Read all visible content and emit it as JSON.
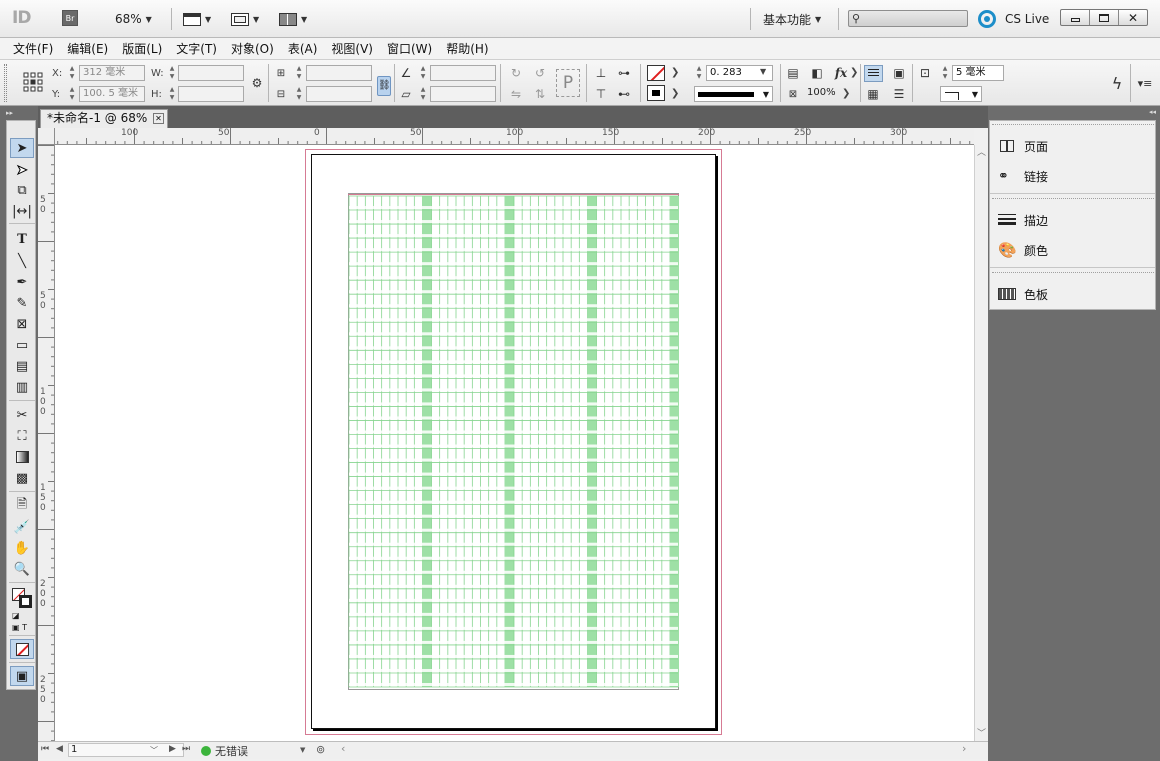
{
  "app": {
    "logo": "ID",
    "bridge_label": "Br",
    "zoom": "68%",
    "workspace": "基本功能",
    "search_placeholder": "",
    "cs_live": "CS Live"
  },
  "menu": [
    "文件(F)",
    "编辑(E)",
    "版面(L)",
    "文字(T)",
    "对象(O)",
    "表(A)",
    "视图(V)",
    "窗口(W)",
    "帮助(H)"
  ],
  "control": {
    "x_label": "X:",
    "x_value": "312 毫米",
    "y_label": "Y:",
    "y_value": "100. 5 毫米",
    "w_label": "W:",
    "h_label": "H:",
    "stroke_weight": "0. 283",
    "opacity": "100%",
    "gap_value": "5 毫米",
    "p_label": "P"
  },
  "document": {
    "tab_title": "*未命名-1 @ 68%",
    "ruler_h": [
      "100",
      "50",
      "0",
      "50",
      "100",
      "150",
      "200",
      "250",
      "300"
    ],
    "ruler_v": [
      "5",
      "0",
      "5",
      "0",
      "1",
      "0",
      "0",
      "1",
      "5",
      "0",
      "2",
      "0",
      "0",
      "2",
      "5",
      "0"
    ],
    "page_field": "1",
    "preflight": "无错误"
  },
  "grid": {
    "columns": 4,
    "cols_per_block": 9,
    "rows": 35,
    "line_color": "#86d48f",
    "bar_color": "#9ee0a6"
  },
  "colors": {
    "accent": "#c2d8ee",
    "margin_pink": "#d67b94",
    "panel_dark": "#6d6d6d"
  },
  "panels": [
    {
      "icon": "pages-icon",
      "label": "页面"
    },
    {
      "icon": "links-icon",
      "label": "链接"
    },
    {
      "icon": "stroke-icon",
      "label": "描边"
    },
    {
      "icon": "color-icon",
      "label": "颜色"
    },
    {
      "icon": "swatches-icon",
      "label": "色板"
    }
  ]
}
